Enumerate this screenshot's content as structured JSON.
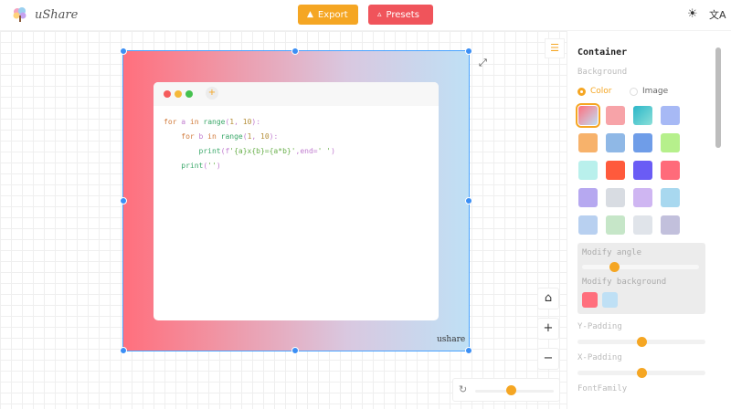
{
  "app": {
    "name": "uShare"
  },
  "toolbar": {
    "export_label": "Export",
    "presets_label": "Presets"
  },
  "code_lines": [
    "for a in range(1, 10):",
    "    for b in range(1, 10):",
    "        print(f'{a}x{b}={a*b}',end=' ')",
    "    print('')"
  ],
  "watermark": "ushare",
  "sidebar": {
    "title": "Container",
    "background_label": "Background",
    "option_color": "Color",
    "option_image": "Image",
    "modify_angle_label": "Modify angle",
    "modify_background_label": "Modify background",
    "y_padding_label": "Y-Padding",
    "x_padding_label": "X-Padding",
    "font_family_label": "FontFamily",
    "selected_background": "Color",
    "angle_value_fraction": 0.27,
    "y_padding_fraction": 0.5,
    "x_padding_fraction": 0.5,
    "swatch_colors": [
      "#ff6f7d-#bfe0f5",
      "#f7a3a8",
      "#2bb6c8-#8be0d9",
      "#a7b9f5",
      "#f7b26b",
      "#8fb8e6",
      "#6f9de8",
      "#b6f08c",
      "#b9f0ec",
      "#ff5a3c",
      "#6a5cf5",
      "#ff6b7a",
      "#b6a8f0",
      "#d8dce2",
      "#cfb6f2",
      "#a8d8ef",
      "#b8d0f0",
      "#c6e6c8",
      "#e0e4ea",
      "#c2c0dc"
    ],
    "bg_colors": [
      "#ff6f7d",
      "#bfe0f5"
    ]
  },
  "zoom_slider_fraction": 0.45,
  "colors": {
    "accent": "#f5a623",
    "presets": "#f0545b",
    "handle": "#3b8ff5"
  }
}
